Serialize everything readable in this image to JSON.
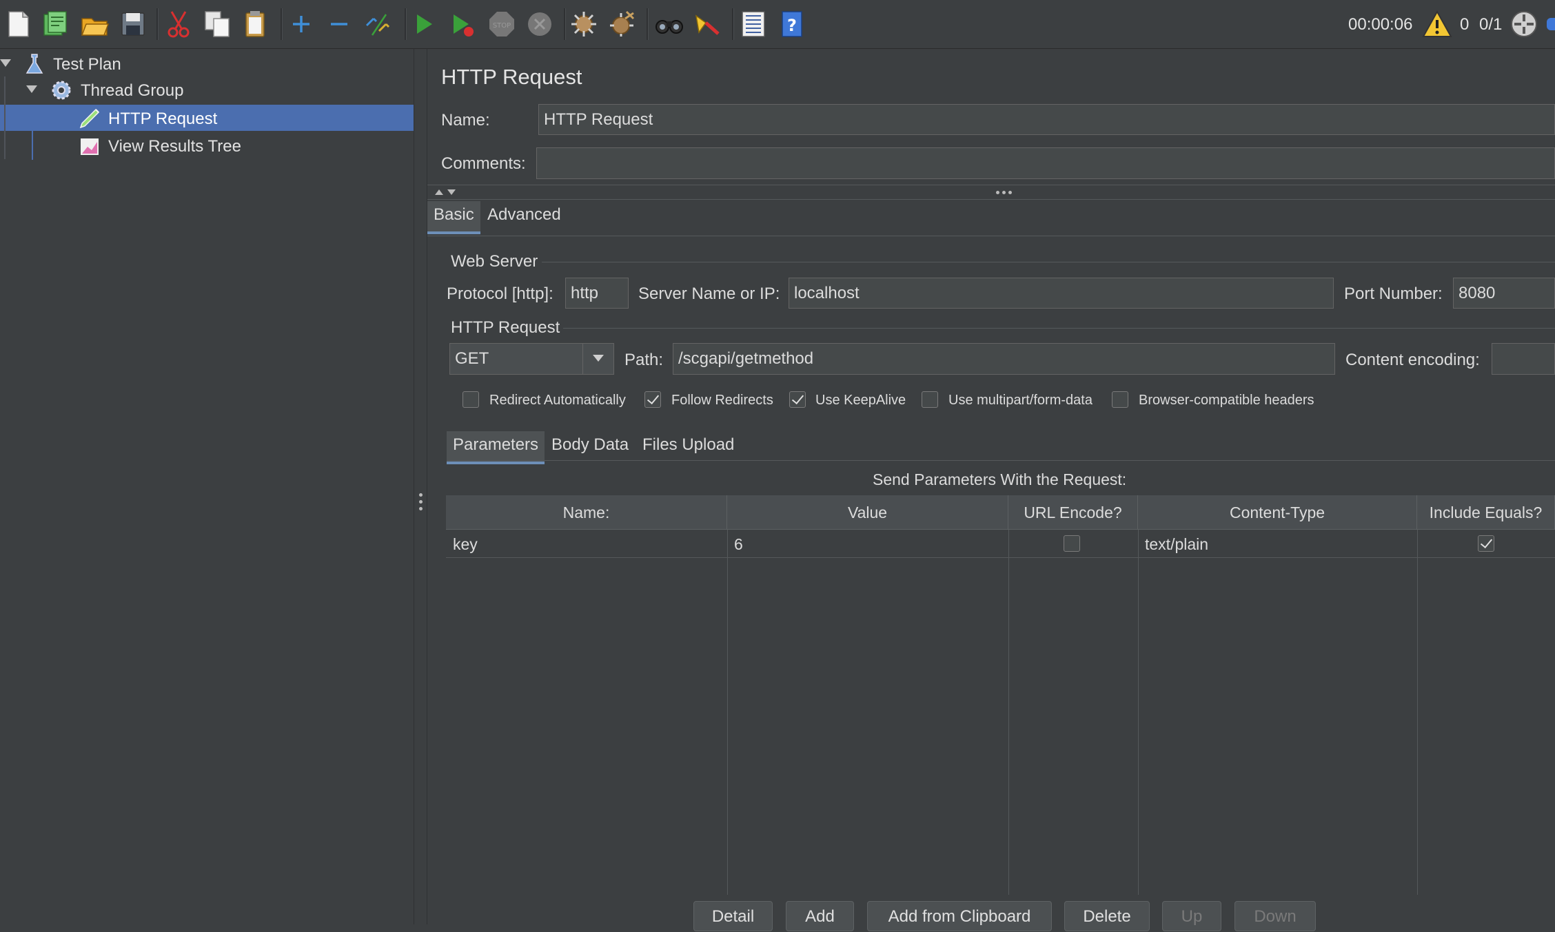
{
  "toolbar": {
    "timer": "00:00:06",
    "warning_count": "0",
    "threads": "0/1"
  },
  "tree": {
    "items": [
      {
        "label": "Test Plan"
      },
      {
        "label": "Thread Group"
      },
      {
        "label": "HTTP Request"
      },
      {
        "label": "View Results Tree"
      }
    ]
  },
  "panel": {
    "title": "HTTP Request",
    "name_label": "Name:",
    "name_value": "HTTP Request",
    "comments_label": "Comments:",
    "comments_value": "",
    "tabs": [
      {
        "label": "Basic",
        "active": true
      },
      {
        "label": "Advanced",
        "active": false
      }
    ],
    "web_server": {
      "group_title": "Web Server",
      "protocol_label": "Protocol [http]:",
      "protocol_value": "http",
      "server_label": "Server Name or IP:",
      "server_value": "localhost",
      "port_label": "Port Number:",
      "port_value": "8080"
    },
    "http_request": {
      "group_title": "HTTP Request",
      "method": "GET",
      "path_label": "Path:",
      "path_value": "/scgapi/getmethod",
      "encoding_label": "Content encoding:",
      "encoding_value": ""
    },
    "options": [
      {
        "label": "Redirect Automatically",
        "checked": false
      },
      {
        "label": "Follow Redirects",
        "checked": true
      },
      {
        "label": "Use KeepAlive",
        "checked": true
      },
      {
        "label": "Use multipart/form-data",
        "checked": false
      },
      {
        "label": "Browser-compatible headers",
        "checked": false
      }
    ],
    "sub_tabs": [
      {
        "label": "Parameters",
        "active": true
      },
      {
        "label": "Body Data",
        "active": false
      },
      {
        "label": "Files Upload",
        "active": false
      }
    ],
    "params_caption": "Send Parameters With the Request:",
    "params_table": {
      "columns": [
        "Name:",
        "Value",
        "URL Encode?",
        "Content-Type",
        "Include Equals?"
      ],
      "rows": [
        {
          "name": "key",
          "value": "6",
          "url_encode": false,
          "content_type": "text/plain",
          "include_equals": true
        }
      ]
    },
    "buttons": [
      {
        "label": "Detail",
        "enabled": true
      },
      {
        "label": "Add",
        "enabled": true
      },
      {
        "label": "Add from Clipboard",
        "enabled": true
      },
      {
        "label": "Delete",
        "enabled": true
      },
      {
        "label": "Up",
        "enabled": false
      },
      {
        "label": "Down",
        "enabled": false
      }
    ]
  },
  "icons": {
    "toolbar": [
      "new-icon",
      "templates-icon",
      "open-icon",
      "save-icon",
      "cut-icon",
      "copy-icon",
      "paste-icon",
      "expand-icon",
      "collapse-icon",
      "toggle-icon",
      "start-icon",
      "start-no-pauses-icon",
      "stop-icon",
      "shutdown-icon",
      "clear-icon",
      "clear-all-icon",
      "search-icon",
      "reset-search-icon",
      "function-helper-icon",
      "help-icon",
      "warning-icon",
      "remote-icon"
    ],
    "tree": [
      "test-plan-icon",
      "thread-group-icon",
      "http-request-icon",
      "view-results-tree-icon"
    ]
  },
  "colors": {
    "selection": "#4b6eaf",
    "background": "#3c3f41",
    "field": "#45494a",
    "start_green": "#3aa13a"
  }
}
